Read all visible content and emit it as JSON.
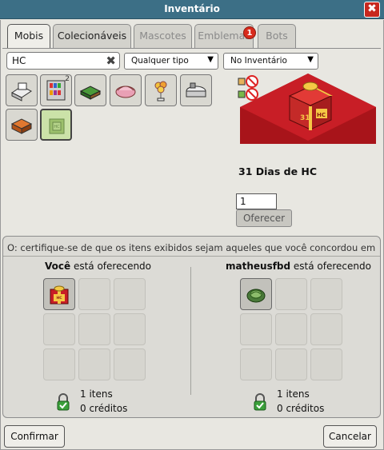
{
  "window": {
    "title": "Inventário",
    "close_label": "✖"
  },
  "tabs": [
    {
      "label": "Mobis",
      "state": "active"
    },
    {
      "label": "Colecionáveis",
      "state": "normal"
    },
    {
      "label": "Mascotes",
      "state": "disabled"
    },
    {
      "label": "Emblemas",
      "state": "disabled",
      "badge": "1"
    },
    {
      "label": "Bots",
      "state": "disabled"
    }
  ],
  "filters": {
    "search_value": "HC",
    "type_select": "Qualquer tipo",
    "location_select": "No Inventário"
  },
  "items": [
    {
      "icon": "computer-desk-icon",
      "count": ""
    },
    {
      "icon": "bookshelf-icon",
      "count": "2"
    },
    {
      "icon": "money-stack-icon",
      "count": ""
    },
    {
      "icon": "pink-shell-icon",
      "count": ""
    },
    {
      "icon": "balloon-lamp-icon",
      "count": ""
    },
    {
      "icon": "bathtub-icon",
      "count": ""
    },
    {
      "icon": "orange-crate-icon",
      "count": ""
    },
    {
      "icon": "hc-green-box-icon",
      "count": "",
      "selected": true
    }
  ],
  "preview": {
    "item_name": "31 Dias de HC",
    "quantity": "1",
    "offer_label": "Oferecer",
    "badge_icons": [
      "no-trade-icon",
      "no-recycle-icon"
    ]
  },
  "trade": {
    "warning": "O: certifique-se de que os itens exibidos sejam aqueles que você concordou em negociar.",
    "you": {
      "name": "Você",
      "suffix": " está oferecendo",
      "items_text": "1 itens",
      "credits_text": "0 créditos",
      "offered_icon": "hc-gift-box-icon"
    },
    "other": {
      "name": "matheusfbd",
      "suffix": " está oferecendo",
      "items_text": "1 itens",
      "credits_text": "0 créditos",
      "offered_icon": "cabbage-icon"
    }
  },
  "buttons": {
    "confirm": "Confirmar",
    "cancel": "Cancelar"
  },
  "colors": {
    "titlebar": "#3c6f86",
    "close": "#c8281e",
    "badge": "#d82b1c",
    "selected_item": "#cbe2a8"
  }
}
